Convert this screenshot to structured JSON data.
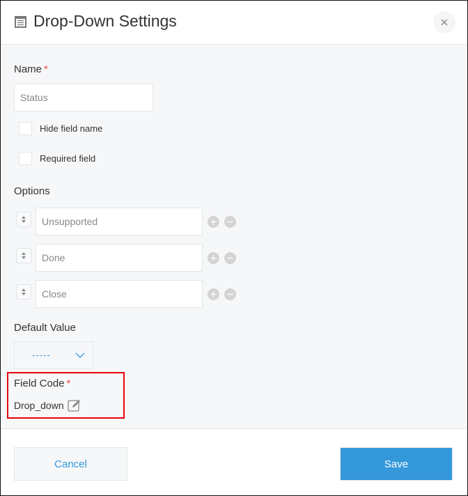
{
  "dialog": {
    "title": "Drop-Down Settings",
    "title_icon": "dropdown-field-icon",
    "close_icon": "close-icon"
  },
  "name_field": {
    "label": "Name",
    "required_mark": "*",
    "value": "Status"
  },
  "checkboxes": [
    {
      "label": "Hide field name",
      "checked": false
    },
    {
      "label": "Required field",
      "checked": false
    }
  ],
  "options": {
    "label": "Options",
    "items": [
      {
        "value": "Unsupported"
      },
      {
        "value": "Done"
      },
      {
        "value": "Close"
      }
    ],
    "add_icon": "plus-circle-icon",
    "remove_icon": "minus-circle-icon",
    "sort_icon": "sort-arrows-icon"
  },
  "default_value": {
    "label": "Default Value",
    "selected": "-----"
  },
  "field_code": {
    "label": "Field Code",
    "required_mark": "*",
    "value": "Drop_down",
    "edit_icon": "edit-icon"
  },
  "footer": {
    "cancel_label": "Cancel",
    "save_label": "Save"
  },
  "colors": {
    "accent": "#3498db",
    "required": "#e74c3c",
    "highlight": "#e8000b"
  }
}
